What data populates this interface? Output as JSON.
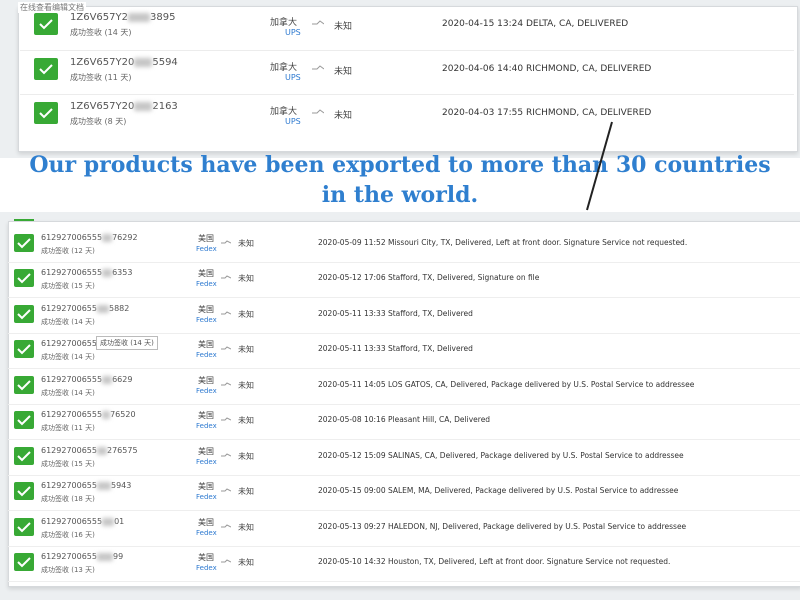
{
  "top": {
    "caption": "在线查看编辑文档",
    "rows": [
      {
        "tracking_prefix": "1Z6V657Y2",
        "tracking_suffix": "3895",
        "status": "成功签收 (14 天)",
        "country": "加拿大",
        "carrier": "UPS",
        "destination": "未知",
        "detail": "2020-04-15 13:24  DELTA, CA, DELIVERED"
      },
      {
        "tracking_prefix": "1Z6V657Y20",
        "tracking_suffix": "5594",
        "status": "成功签收 (11 天)",
        "country": "加拿大",
        "carrier": "UPS",
        "destination": "未知",
        "detail": "2020-04-06 14:40  RICHMOND, CA, DELIVERED"
      },
      {
        "tracking_prefix": "1Z6V657Y20",
        "tracking_suffix": "2163",
        "status": "成功签收 (8 天)",
        "country": "加拿大",
        "carrier": "UPS",
        "destination": "未知",
        "detail": "2020-04-03 17:55  RICHMOND, CA, DELIVERED"
      }
    ]
  },
  "headline": {
    "line1": "Our products have been exported to more than 30 countries",
    "line2": "in the world."
  },
  "bottom": {
    "tooltip": "成功签收 (14 天)",
    "rows": [
      {
        "tracking_prefix": "612927006555",
        "tracking_suffix": "76292",
        "status": "成功签收 (12 天)",
        "country": "美国",
        "carrier": "Fedex",
        "destination": "未知",
        "detail": "2020-05-09 11:52  Missouri City, TX, Delivered, Left at front door. Signature Service not requested."
      },
      {
        "tracking_prefix": "612927006555",
        "tracking_suffix": "6353",
        "status": "成功签收 (15 天)",
        "country": "美国",
        "carrier": "Fedex",
        "destination": "未知",
        "detail": "2020-05-12 17:06  Stafford, TX, Delivered, Signature on file"
      },
      {
        "tracking_prefix": "61292700655",
        "tracking_suffix": "5882",
        "status": "成功签收 (14 天)",
        "country": "美国",
        "carrier": "Fedex",
        "destination": "未知",
        "detail": "2020-05-11 13:33  Stafford, TX, Delivered"
      },
      {
        "tracking_prefix": "61292700655",
        "tracking_suffix": "",
        "status": "成功签收 (14 天)",
        "country": "美国",
        "carrier": "Fedex",
        "destination": "未知",
        "detail": "2020-05-11 13:33  Stafford, TX, Delivered"
      },
      {
        "tracking_prefix": "612927006555",
        "tracking_suffix": "6629",
        "status": "成功签收 (14 天)",
        "country": "美国",
        "carrier": "Fedex",
        "destination": "未知",
        "detail": "2020-05-11 14:05  LOS GATOS, CA, Delivered, Package delivered by U.S. Postal Service to addressee"
      },
      {
        "tracking_prefix": "612927006555",
        "tracking_suffix": "76520",
        "status": "成功签收 (11 天)",
        "country": "美国",
        "carrier": "Fedex",
        "destination": "未知",
        "detail": "2020-05-08 10:16  Pleasant Hill, CA, Delivered"
      },
      {
        "tracking_prefix": "61292700655",
        "tracking_suffix": "276575",
        "status": "成功签收 (15 天)",
        "country": "美国",
        "carrier": "Fedex",
        "destination": "未知",
        "detail": "2020-05-12 15:09  SALINAS, CA, Delivered, Package delivered by U.S. Postal Service to addressee"
      },
      {
        "tracking_prefix": "61292700655",
        "tracking_suffix": "5943",
        "status": "成功签收 (18 天)",
        "country": "美国",
        "carrier": "Fedex",
        "destination": "未知",
        "detail": "2020-05-15 09:00  SALEM, MA, Delivered, Package delivered by U.S. Postal Service to addressee"
      },
      {
        "tracking_prefix": "612927006555",
        "tracking_suffix": "01",
        "status": "成功签收 (16 天)",
        "country": "美国",
        "carrier": "Fedex",
        "destination": "未知",
        "detail": "2020-05-13 09:27  HALEDON, NJ, Delivered, Package delivered by U.S. Postal Service to addressee"
      },
      {
        "tracking_prefix": "61292700655",
        "tracking_suffix": "99",
        "status": "成功签收 (13 天)",
        "country": "美国",
        "carrier": "Fedex",
        "destination": "未知",
        "detail": "2020-05-10 14:32  Houston, TX, Delivered, Left at front door. Signature Service not requested."
      }
    ]
  },
  "colors": {
    "check_green": "#38a935",
    "headline_blue": "#2f7fcf",
    "carrier_blue": "#2e7ad0",
    "panel_bg": "#eceff1"
  },
  "icons": {
    "status": "check-icon",
    "route": "arrow-icon"
  }
}
